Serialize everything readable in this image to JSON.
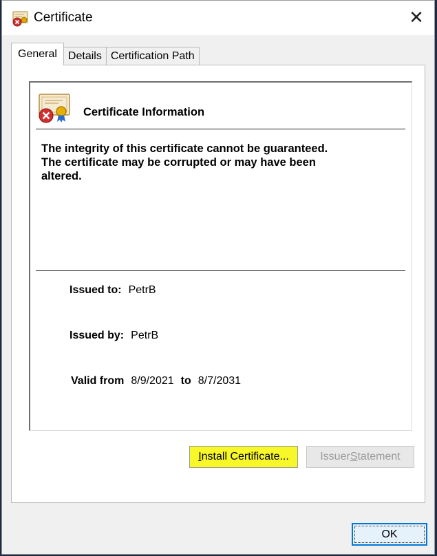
{
  "window": {
    "title": "Certificate",
    "close_glyph": "✕"
  },
  "tabs": [
    {
      "label": "General",
      "active": true
    },
    {
      "label": "Details",
      "active": false
    },
    {
      "label": "Certification Path",
      "active": false
    }
  ],
  "info": {
    "heading": "Certificate Information",
    "warning_line1": "The integrity of this certificate cannot be guaranteed.",
    "warning_line2": "The certificate may be corrupted or may have been",
    "warning_line3": "altered."
  },
  "fields": {
    "issued_to_label": "Issued to:",
    "issued_to_value": "PetrB",
    "issued_by_label": "Issued by:",
    "issued_by_value": "PetrB",
    "valid_from_label": "Valid from",
    "valid_from_value": "8/9/2021",
    "valid_to_label": "to",
    "valid_to_value": "8/7/2031"
  },
  "buttons": {
    "install_pre": "I",
    "install_rest": "nstall Certificate...",
    "issuer_pre": "Issuer ",
    "issuer_u": "S",
    "issuer_rest": "tatement",
    "ok": "OK"
  },
  "icons": {
    "title_icon": "certificate-error-icon",
    "info_icon": "certificate-error-icon",
    "close_icon": "close-icon"
  },
  "colors": {
    "highlight": "#f7f72a",
    "ok_border": "#0078d7",
    "error_red": "#d32f2f"
  }
}
